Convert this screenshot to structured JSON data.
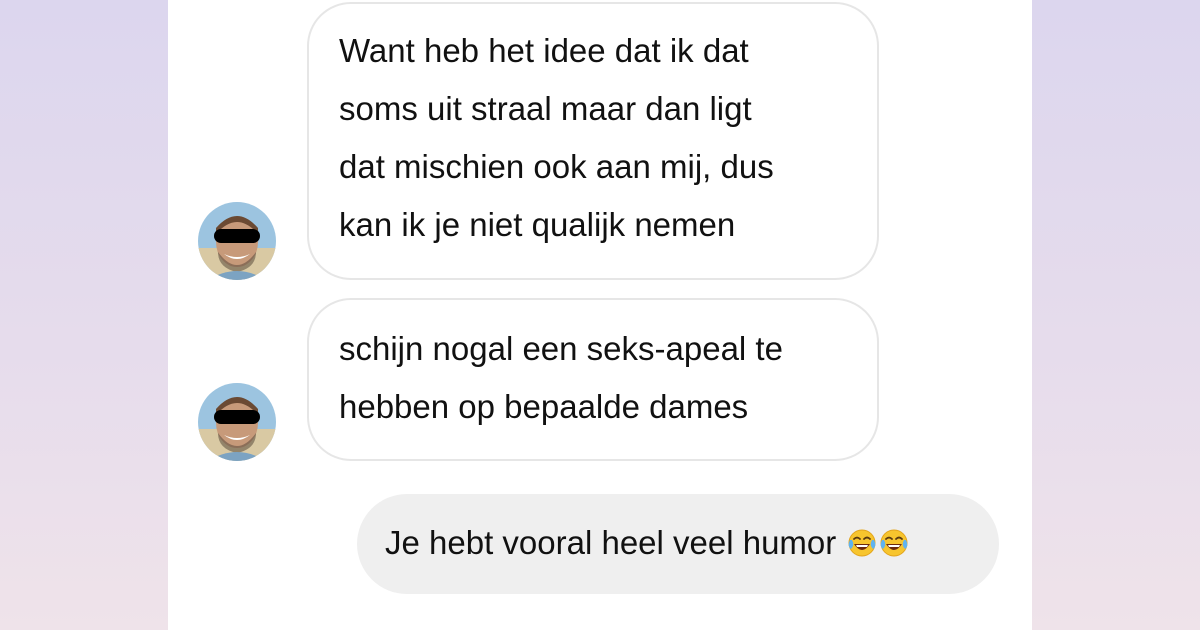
{
  "conversation": {
    "messages": [
      {
        "sender": "other",
        "lines": [
          "Want heb het idee dat ik dat",
          "soms uit straal maar dan ligt",
          "dat mischien ook aan mij, dus",
          "kan ik je niet qualijk nemen"
        ]
      },
      {
        "sender": "other",
        "lines": [
          "schijn nogal een seks-apeal te",
          "hebben op bepaalde dames"
        ]
      },
      {
        "sender": "me",
        "text": "Je hebt vooral heel veel humor",
        "emojis": [
          "tears-of-joy-emoji",
          "tears-of-joy-emoji"
        ]
      }
    ]
  },
  "colors": {
    "incoming_bubble_border": "#e6e6e6",
    "outgoing_bubble": "#efefef",
    "text": "#111111"
  }
}
